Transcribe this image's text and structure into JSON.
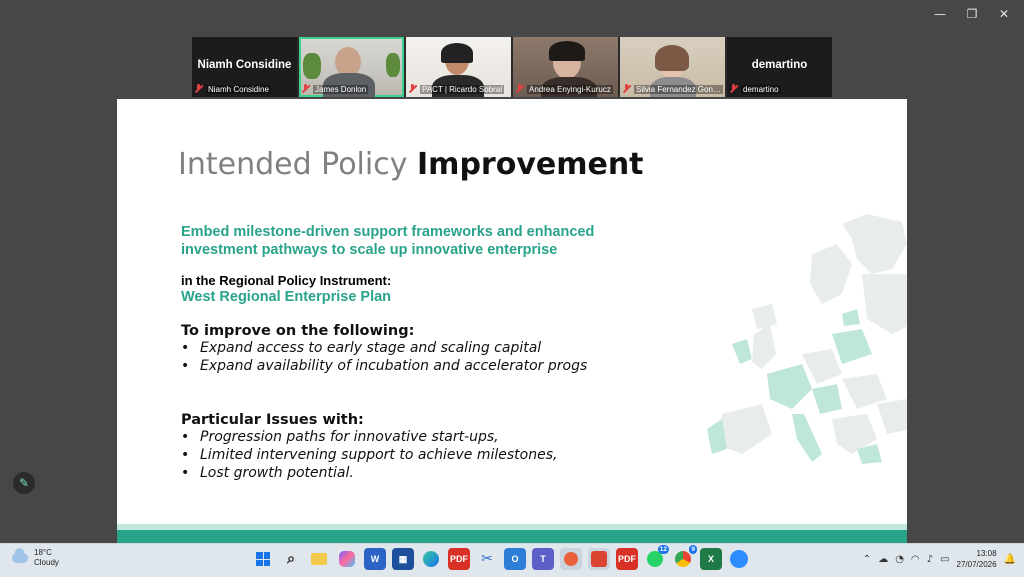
{
  "window_controls": {
    "minimize_glyph": "—",
    "restore_glyph": "❐",
    "close_glyph": "✕"
  },
  "participants": [
    {
      "big_name": "Niamh Considine",
      "label": "Niamh Considine",
      "video": false
    },
    {
      "big_name": "",
      "label": "James Donlon",
      "video": true,
      "active": true
    },
    {
      "big_name": "",
      "label": "PACT | Ricardo Sobral",
      "video": true
    },
    {
      "big_name": "",
      "label": "Andrea Enyingi-Kurucz",
      "video": true
    },
    {
      "big_name": "",
      "label": "Silvia Fernandez Gonz...",
      "video": true
    },
    {
      "big_name": "demartino",
      "label": "demartino",
      "video": false
    }
  ],
  "slide": {
    "title_light": "Intended Policy",
    "title_bold": "Improvement",
    "headline": "Embed milestone-driven support frameworks and enhanced investment pathways to scale up innovative enterprise",
    "instrument_label": "in the Regional Policy Instrument:",
    "instrument_value": "West Regional Enterprise Plan",
    "improve": {
      "heading": "To improve on the following:",
      "items": [
        "Expand access to early stage and scaling capital",
        "Expand availability of incubation and accelerator progs"
      ]
    },
    "issues": {
      "heading": "Particular Issues with:",
      "items": [
        "Progression paths for innovative start-ups,",
        "Limited intervening support to achieve milestones,",
        "Lost growth potential."
      ]
    }
  },
  "taskbar": {
    "weather_temp": "18°C",
    "weather_desc": "Cloudy",
    "apps": [
      "start-icon",
      "search-icon",
      "file-explorer-icon",
      "copilot-icon",
      "word-icon",
      "store-icon",
      "edge-icon",
      "pdf-icon",
      "snipping-tool-icon",
      "outlook-icon",
      "teams-icon",
      "app-icon",
      "outlook-new-icon",
      "pdf-icon-2",
      "whatsapp-icon",
      "chrome-icon",
      "excel-icon",
      "zoom-icon"
    ],
    "whatsapp_badge": "12",
    "chrome_badge": "9",
    "time": "13:08",
    "date": "27/07/2026"
  },
  "colors": {
    "accent_green": "#2aa38b",
    "active_tile": "#3ed08e"
  }
}
